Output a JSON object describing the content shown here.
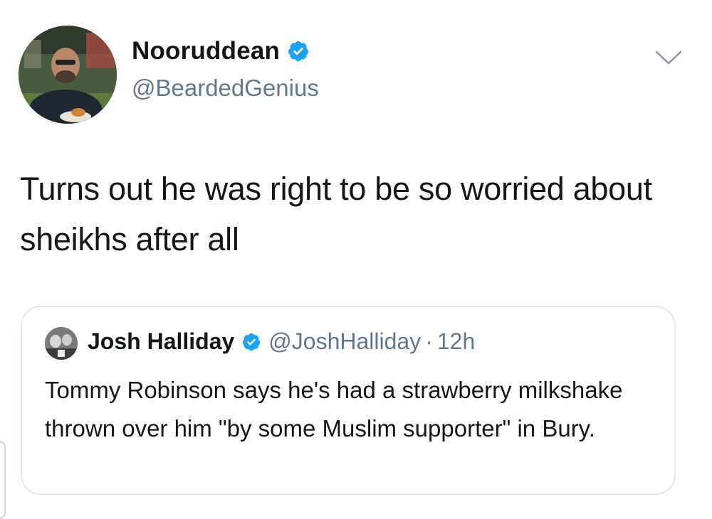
{
  "tweet": {
    "author_name": "Nooruddean",
    "author_handle": "@BeardedGenius",
    "verified": true,
    "text": "Turns out he was right to be so worried about sheikhs after all",
    "icons": {
      "verified": "verified-badge-icon",
      "menu": "chevron-down-icon"
    }
  },
  "quoted_tweet": {
    "author_name": "Josh Halliday",
    "author_handle": "@JoshHalliday",
    "separator": "·",
    "time": "12h",
    "verified": true,
    "text": "Tommy Robinson says he's had a strawberry milkshake thrown over him \"by some Muslim supporter\" in Bury."
  },
  "colors": {
    "verified_blue": "#1DA1F2",
    "secondary_text": "#657786",
    "primary_text": "#14171A",
    "border": "#E1E8ED"
  }
}
